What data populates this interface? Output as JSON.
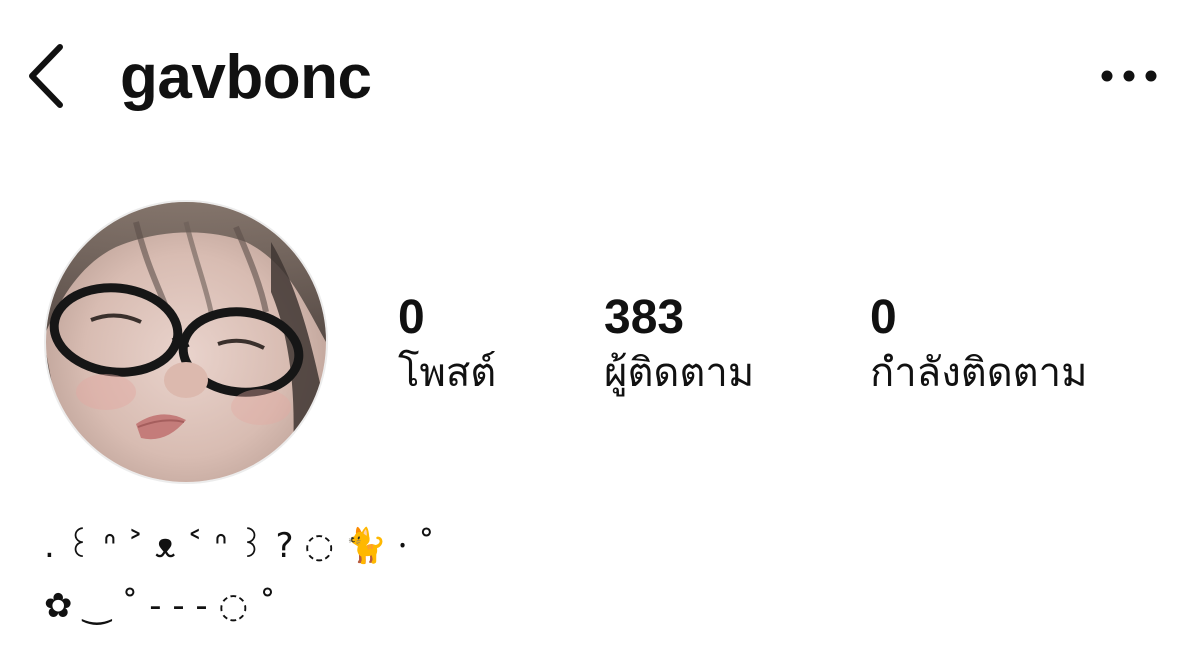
{
  "header": {
    "username": "gavbonc",
    "back_icon": "chevron-left-icon",
    "more_icon": "more-horizontal-icon"
  },
  "stats": {
    "posts": {
      "value": "0",
      "label": "โพสต์"
    },
    "followers": {
      "value": "383",
      "label": "ผู้ติดตาม"
    },
    "following": {
      "value": "0",
      "label": "กำลังติดตาม"
    }
  },
  "bio": {
    "line1": ". ꒰ ᐢ ˃ ᴥ ˂ ᐢ ꒱ ? ◌ 🐈 ⸱ ˚",
    "line2": "✿ ‿ ˚ - - - ◌ ˚"
  },
  "colors": {
    "background": "#ffffff",
    "text": "#111111"
  }
}
